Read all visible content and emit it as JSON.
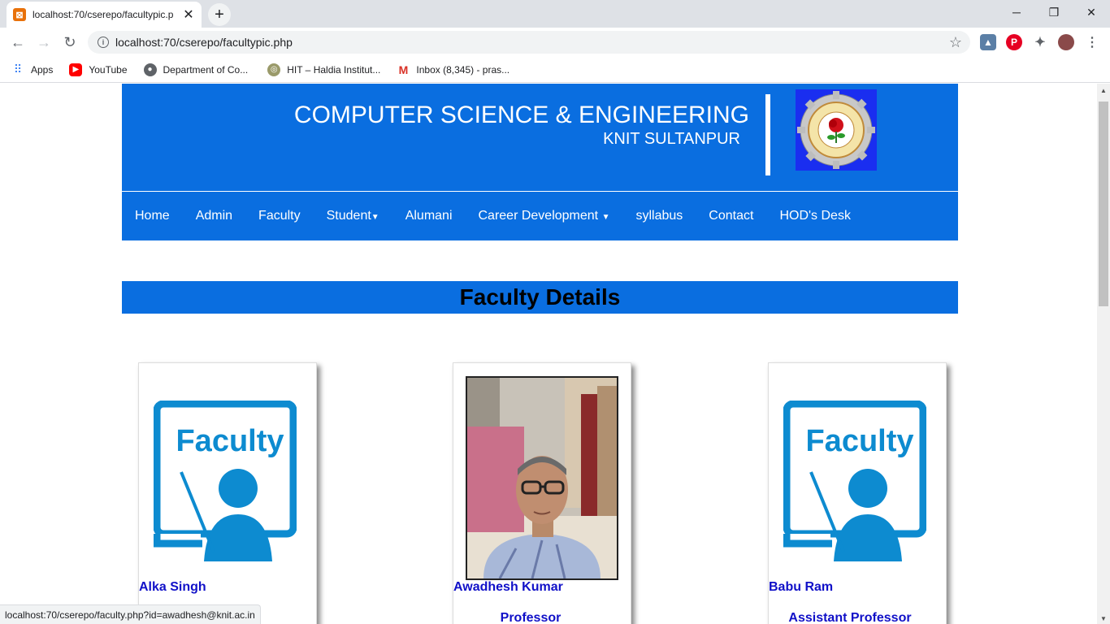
{
  "browser": {
    "tab_title": "localhost:70/cserepo/facultypic.p",
    "url": "localhost:70/cserepo/facultypic.php",
    "bookmarks": [
      {
        "label": "Apps",
        "icon": "apps-grid-icon"
      },
      {
        "label": "YouTube",
        "icon": "youtube-icon"
      },
      {
        "label": "Department of Co...",
        "icon": "globe-icon"
      },
      {
        "label": "HIT – Haldia Institut...",
        "icon": "hit-logo-icon"
      },
      {
        "label": "Inbox (8,345) - pras...",
        "icon": "gmail-icon"
      }
    ],
    "status_url": "localhost:70/cserepo/faculty.php?id=awadhesh@knit.ac.in"
  },
  "header": {
    "title": "COMPUTER SCIENCE & ENGINEERING",
    "subtitle": "KNIT SULTANPUR"
  },
  "nav": {
    "items": [
      {
        "label": "Home",
        "dropdown": false
      },
      {
        "label": "Admin",
        "dropdown": false
      },
      {
        "label": "Faculty",
        "dropdown": false
      },
      {
        "label": "Student",
        "dropdown": true
      },
      {
        "label": "Alumani",
        "dropdown": false
      },
      {
        "label": "Career Development ",
        "dropdown": true
      },
      {
        "label": "syllabus",
        "dropdown": false
      },
      {
        "label": "Contact",
        "dropdown": false
      },
      {
        "label": "HOD's Desk",
        "dropdown": false
      }
    ]
  },
  "page": {
    "heading": "Faculty Details"
  },
  "faculty": [
    {
      "name": "Alka Singh",
      "role": "",
      "photo": "faculty-placeholder"
    },
    {
      "name": "Awadhesh Kumar",
      "role": "Professor",
      "photo": "portrait"
    },
    {
      "name": "Babu Ram",
      "role": "Assistant Professor",
      "photo": "faculty-placeholder"
    }
  ],
  "faculty_icon_text": "Faculty",
  "colors": {
    "brand_blue": "#0a6ee0",
    "faculty_icon_blue": "#0d8bd0",
    "name_color": "#1010c8"
  }
}
